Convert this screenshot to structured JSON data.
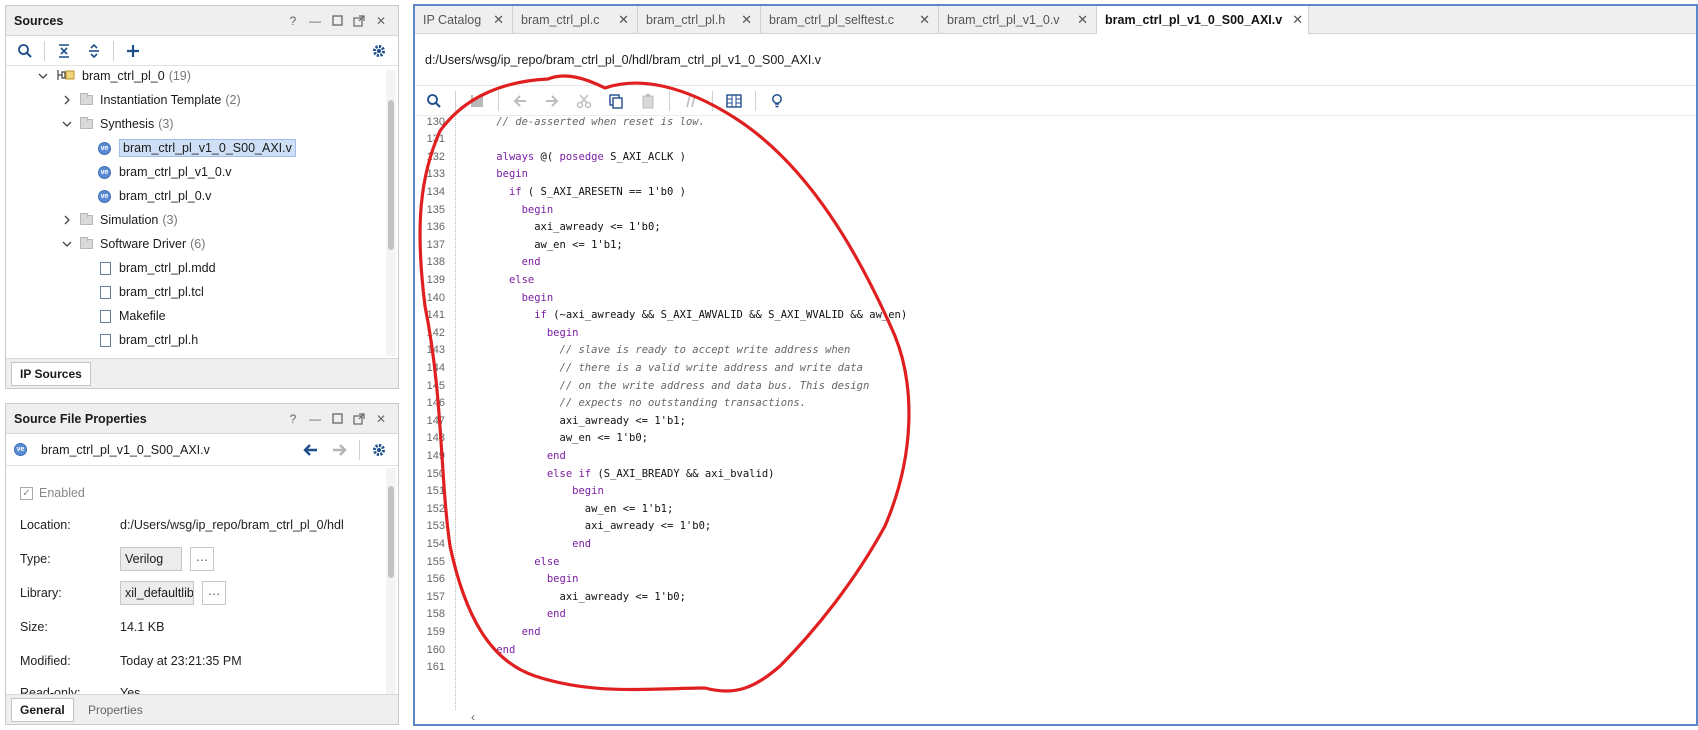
{
  "sources": {
    "title": "Sources",
    "tree": [
      {
        "label": "bram_ctrl_pl_0",
        "count": "(19)",
        "kind": "ip-root",
        "expanded": true
      },
      {
        "label": "Instantiation Template",
        "count": "(2)",
        "kind": "folder",
        "expanded": false
      },
      {
        "label": "Synthesis",
        "count": "(3)",
        "kind": "folder",
        "expanded": true
      },
      {
        "label": "bram_ctrl_pl_v1_0_S00_AXI.v",
        "count": "",
        "kind": "verilog",
        "selected": true
      },
      {
        "label": "bram_ctrl_pl_v1_0.v",
        "count": "",
        "kind": "verilog"
      },
      {
        "label": "bram_ctrl_pl_0.v",
        "count": "",
        "kind": "verilog"
      },
      {
        "label": "Simulation",
        "count": "(3)",
        "kind": "folder",
        "expanded": false
      },
      {
        "label": "Software Driver",
        "count": "(6)",
        "kind": "folder",
        "expanded": true
      },
      {
        "label": "bram_ctrl_pl.mdd",
        "count": "",
        "kind": "file"
      },
      {
        "label": "bram_ctrl_pl.tcl",
        "count": "",
        "kind": "tcl"
      },
      {
        "label": "Makefile",
        "count": "",
        "kind": "file"
      },
      {
        "label": "bram_ctrl_pl.h",
        "count": "",
        "kind": "file"
      }
    ],
    "bottom_tab": "IP Sources"
  },
  "properties": {
    "title": "Source File Properties",
    "file_name": "bram_ctrl_pl_v1_0_S00_AXI.v",
    "enabled_label": "Enabled",
    "rows": {
      "location_label": "Location:",
      "location": "d:/Users/wsg/ip_repo/bram_ctrl_pl_0/hdl",
      "type_label": "Type:",
      "type": "Verilog",
      "library_label": "Library:",
      "library": "xil_defaultlib",
      "size_label": "Size:",
      "size": "14.1 KB",
      "modified_label": "Modified:",
      "modified": "Today at 23:21:35 PM",
      "readonly_label": "Read-only:",
      "readonly": "Yes"
    },
    "tabs": [
      "General",
      "Properties"
    ]
  },
  "editor": {
    "tabs": [
      "IP Catalog",
      "bram_ctrl_pl.c",
      "bram_ctrl_pl.h",
      "bram_ctrl_pl_selftest.c",
      "bram_ctrl_pl_v1_0.v",
      "bram_ctrl_pl_v1_0_S00_AXI.v"
    ],
    "path": "d:/Users/wsg/ip_repo/bram_ctrl_pl_0/hdl/bram_ctrl_pl_v1_0_S00_AXI.v",
    "lines": [
      {
        "n": "130",
        "text": "    // de-asserted when reset is low."
      },
      {
        "n": "131",
        "text": ""
      },
      {
        "n": "132",
        "text": "    always @( posedge S_AXI_ACLK )"
      },
      {
        "n": "133",
        "text": "    begin"
      },
      {
        "n": "134",
        "text": "      if ( S_AXI_ARESETN == 1'b0 )"
      },
      {
        "n": "135",
        "text": "        begin"
      },
      {
        "n": "136",
        "text": "          axi_awready <= 1'b0;"
      },
      {
        "n": "137",
        "text": "          aw_en <= 1'b1;"
      },
      {
        "n": "138",
        "text": "        end"
      },
      {
        "n": "139",
        "text": "      else"
      },
      {
        "n": "140",
        "text": "        begin"
      },
      {
        "n": "141",
        "text": "          if (~axi_awready && S_AXI_AWVALID && S_AXI_WVALID && aw_en)"
      },
      {
        "n": "142",
        "text": "            begin"
      },
      {
        "n": "143",
        "text": "              // slave is ready to accept write address when"
      },
      {
        "n": "144",
        "text": "              // there is a valid write address and write data"
      },
      {
        "n": "145",
        "text": "              // on the write address and data bus. This design"
      },
      {
        "n": "146",
        "text": "              // expects no outstanding transactions."
      },
      {
        "n": "147",
        "text": "              axi_awready <= 1'b1;"
      },
      {
        "n": "148",
        "text": "              aw_en <= 1'b0;"
      },
      {
        "n": "149",
        "text": "            end"
      },
      {
        "n": "150",
        "text": "            else if (S_AXI_BREADY && axi_bvalid)"
      },
      {
        "n": "151",
        "text": "                begin"
      },
      {
        "n": "152",
        "text": "                  aw_en <= 1'b1;"
      },
      {
        "n": "153",
        "text": "                  axi_awready <= 1'b0;"
      },
      {
        "n": "154",
        "text": "                end"
      },
      {
        "n": "155",
        "text": "          else"
      },
      {
        "n": "156",
        "text": "            begin"
      },
      {
        "n": "157",
        "text": "              axi_awready <= 1'b0;"
      },
      {
        "n": "158",
        "text": "            end"
      },
      {
        "n": "159",
        "text": "        end"
      },
      {
        "n": "160",
        "text": "    end"
      },
      {
        "n": "161",
        "text": ""
      }
    ]
  },
  "colors": {
    "keyword": "#7b1fa2",
    "comment": "#666666",
    "annotation": "#e02020",
    "editor_border": "#5d87c9",
    "selection": "#cfe0f6"
  }
}
